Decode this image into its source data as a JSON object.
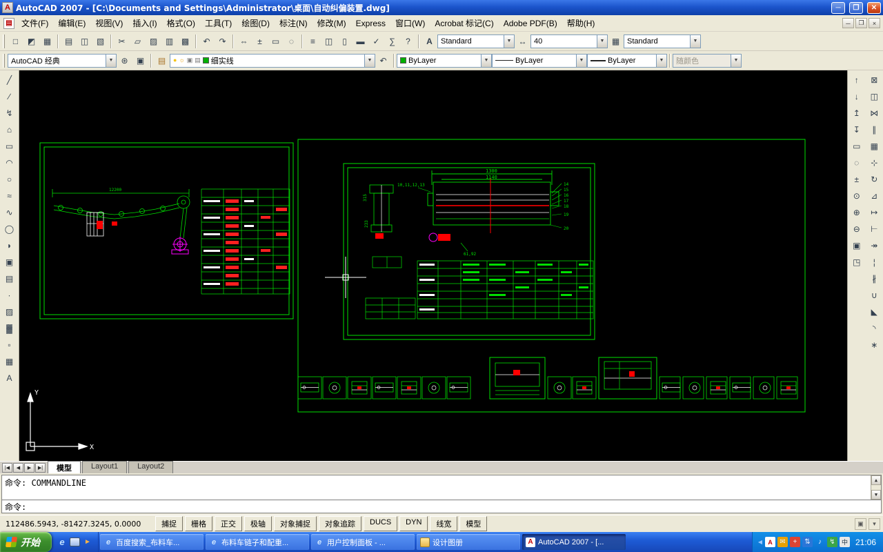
{
  "window": {
    "title": "AutoCAD 2007 - [C:\\Documents and Settings\\Administrator\\桌面\\自动纠偏装置.dwg]"
  },
  "menu_bar": {
    "items": [
      "文件(F)",
      "编辑(E)",
      "视图(V)",
      "插入(I)",
      "格式(O)",
      "工具(T)",
      "绘图(D)",
      "标注(N)",
      "修改(M)",
      "Express",
      "窗口(W)",
      "Acrobat 标记(C)",
      "Adobe PDF(B)",
      "帮助(H)"
    ]
  },
  "standard_toolbar": {
    "groups": [
      [
        "qnew",
        "open",
        "save"
      ],
      [
        "plot",
        "plot-preview",
        "publish"
      ],
      [
        "cut",
        "copy",
        "paste",
        "match-properties",
        "block-editor"
      ],
      [
        "undo",
        "redo"
      ],
      [
        "pan",
        "zoom-realtime",
        "zoom-window",
        "zoom-previous"
      ],
      [
        "properties",
        "designcenter",
        "tool-palettes",
        "sheetset-manager",
        "markup-set-manager",
        "quickcalc",
        "help"
      ]
    ]
  },
  "styles_toolbar": {
    "text_style": "Standard",
    "dim_style": "40",
    "table_style": "Standard"
  },
  "workspace_toolbar": {
    "workspace": "AutoCAD 经典"
  },
  "layers_toolbar": {
    "current_layer": "细实线"
  },
  "properties_toolbar": {
    "color": "ByLayer",
    "linetype": "ByLayer",
    "lineweight": "ByLayer",
    "plot_style": "随颜色"
  },
  "draw_toolbar": {
    "icons": [
      "line",
      "construction-line",
      "polyline",
      "polygon",
      "rectangle",
      "arc",
      "circle",
      "revision-cloud",
      "spline",
      "ellipse",
      "ellipse-arc",
      "insert-block",
      "make-block",
      "point",
      "hatch",
      "gradient",
      "region",
      "table",
      "multiline-text"
    ]
  },
  "order_toolbar": {
    "icons": [
      "bring-to-front",
      "send-to-back",
      "bring-above",
      "send-under",
      "zoom-window2",
      "zoom-dynamic",
      "zoom-scale",
      "zoom-center",
      "zoom-in",
      "zoom-out",
      "zoom-all",
      "zoom-extents"
    ]
  },
  "modify_toolbar": {
    "icons": [
      "erase",
      "copy-object",
      "mirror",
      "offset",
      "array",
      "move",
      "rotate",
      "scale",
      "stretch",
      "trim",
      "extend",
      "break-at-point",
      "break",
      "join",
      "chamfer",
      "fillet",
      "explode"
    ]
  },
  "drawing": {
    "left_view": {
      "overall_dim": "12200"
    },
    "right_view": {
      "dim_outer": "1300",
      "dim_inner": "1140",
      "callouts_right": [
        "14",
        "15",
        "16",
        "17",
        "18",
        "19",
        "20"
      ],
      "callout_left": "10,11,12,13",
      "callout_bottom": "61,92",
      "dim_side_a": "315",
      "dim_side_b": "233"
    }
  },
  "ucs": {
    "x_label": "X",
    "y_label": "Y"
  },
  "layout_tabs": {
    "tabs": [
      "模型",
      "Layout1",
      "Layout2"
    ],
    "active_index": 0
  },
  "command_line": {
    "history": "命令: COMMANDLINE",
    "prompt": "命令:"
  },
  "status_bar": {
    "coordinates": "112486.5943, -81427.3245, 0.0000",
    "toggles": [
      "捕捉",
      "栅格",
      "正交",
      "极轴",
      "对象捕捉",
      "对象追踪",
      "DUCS",
      "DYN",
      "线宽",
      "模型"
    ]
  },
  "taskbar": {
    "start_label": "开始",
    "quick_launch": [
      "ie",
      "desktop",
      "media"
    ],
    "tasks": [
      {
        "icon": "ie",
        "label": "百度搜索_布料车..."
      },
      {
        "icon": "ie",
        "label": "布料车链子和配重..."
      },
      {
        "icon": "ie",
        "label": "用户控制面板 - ..."
      },
      {
        "icon": "folder",
        "label": "设计图册"
      },
      {
        "icon": "acad",
        "label": "AutoCAD 2007 - [...",
        "active": true
      }
    ],
    "tray_icons": [
      "acad",
      "msg",
      "shield",
      "network",
      "volume",
      "usb",
      "ime"
    ],
    "tray_time": "21:06",
    "accent_colors": {
      "taskbar_blue": "#1e5cd6",
      "start_green": "#3d8f2d",
      "xp_face": "#ECE9D8",
      "cad_green": "#00E000"
    }
  }
}
